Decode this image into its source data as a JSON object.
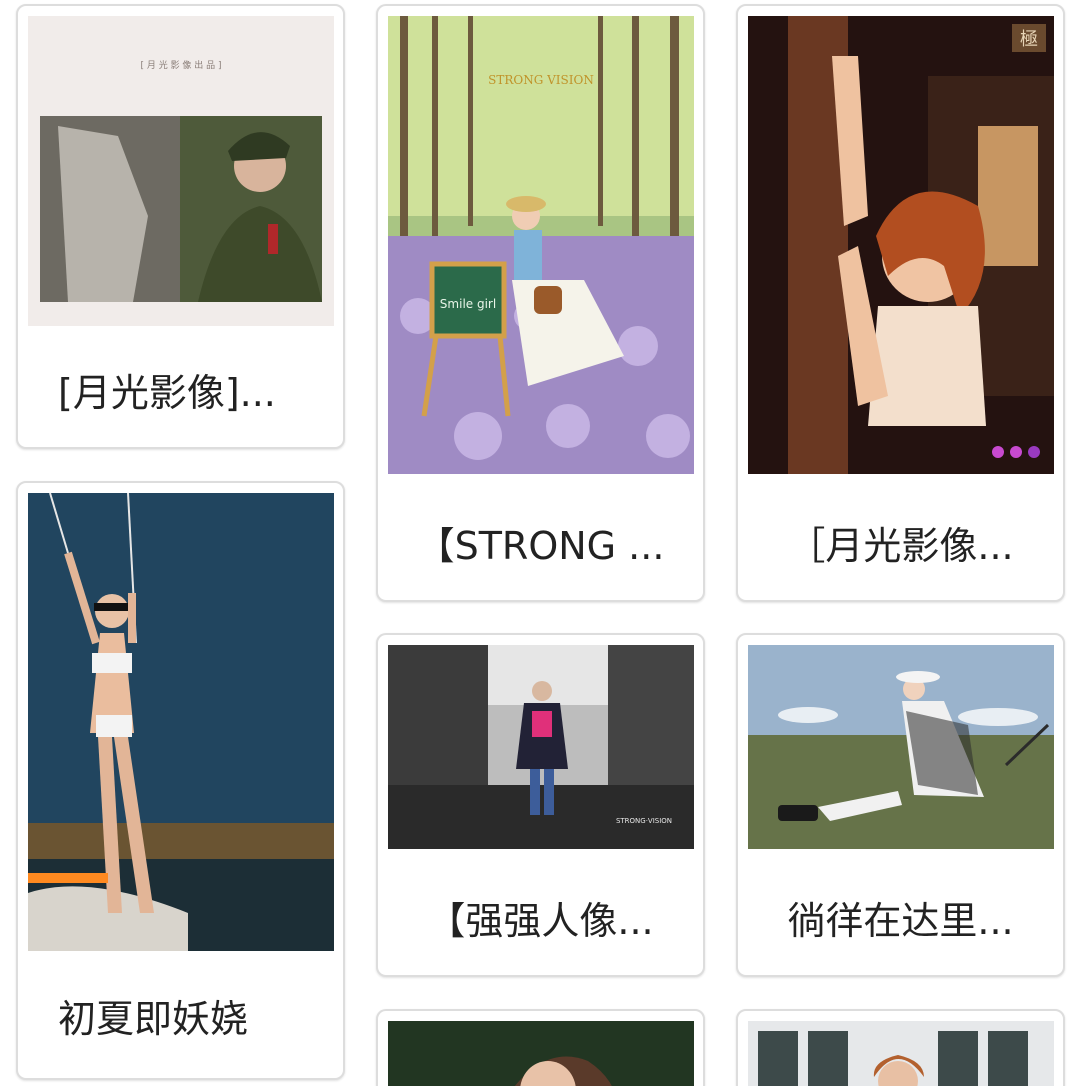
{
  "gallery": {
    "cards": [
      {
        "caption": "[月光影像]..."
      },
      {
        "caption": "初夏即妖娆"
      },
      {
        "caption": "【STRONG ..."
      },
      {
        "caption": "［月光影像..."
      },
      {
        "caption": "【强强人像..."
      },
      {
        "caption": "徜徉在达里..."
      },
      {
        "caption": ""
      },
      {
        "caption": ""
      }
    ],
    "overlays": {
      "strong_vision_logo": "STRONG VISION",
      "smile_girl_board": "Smile girl",
      "strong_vision_small": "STRONG·VISION",
      "moonlight_stamp": "極",
      "poster_header": "[ 月 光 影 像 出 品 ]"
    }
  }
}
